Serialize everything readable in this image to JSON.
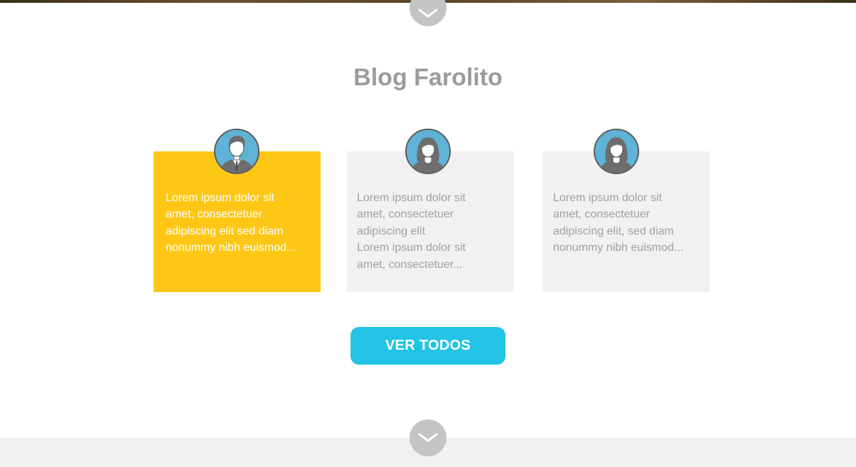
{
  "blog": {
    "title": "Blog Farolito",
    "cards": [
      {
        "text": "Lorem ipsum dolor sit\namet, consectetuer\nadipiscing elit sed diam\nnonummy nibh euismod...",
        "avatar": "male-user-icon",
        "highlighted": true
      },
      {
        "text": "Lorem ipsum dolor sit\namet, consectetuer\nadipiscing elit\nLorem ipsum dolor sit\namet, consectetuer...",
        "avatar": "female-user-icon",
        "highlighted": false
      },
      {
        "text": "Lorem ipsum dolor sit\namet, consectetuer\nadipiscing elit, sed diam\nnonummy nibh euismod...",
        "avatar": "female-user-icon",
        "highlighted": false
      }
    ],
    "cta_label": "VER TODOS"
  },
  "icons": {
    "scroll_top": "chevron-down-icon",
    "scroll_bottom": "chevron-down-icon"
  },
  "colors": {
    "highlight_card": "#fec716",
    "card_bg": "#f1f1f1",
    "cta_bg": "#22c3e6",
    "title": "#9b9b9b",
    "scroll_button": "#c4c4c4",
    "avatar_bg": "#5fb3d6"
  }
}
